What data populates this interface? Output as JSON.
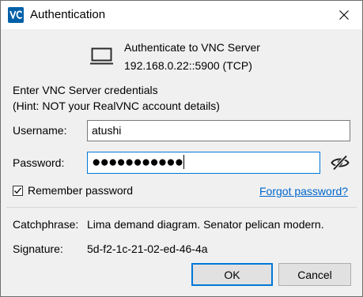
{
  "window": {
    "title": "Authentication",
    "app_icon": "vnc-viewer-icon"
  },
  "server": {
    "title": "Authenticate to VNC Server",
    "address": "192.168.0.22::5900 (TCP)"
  },
  "credentials": {
    "prompt_line1": "Enter VNC Server credentials",
    "prompt_line2": "(Hint: NOT your RealVNC account details)",
    "username_label": "Username:",
    "username_value": "atushi",
    "password_label": "Password:",
    "password_value": "●●●●●●●●●●●",
    "remember_label": "Remember password",
    "remember_checked": true,
    "forgot_link": "Forgot password?"
  },
  "identity": {
    "catchphrase_label": "Catchphrase:",
    "catchphrase_value": "Lima demand diagram. Senator pelican modern.",
    "signature_label": "Signature:",
    "signature_value": "5d-f2-1c-21-02-ed-46-4a"
  },
  "buttons": {
    "ok": "OK",
    "cancel": "Cancel"
  },
  "colors": {
    "accent": "#0078d7",
    "link": "#0066cc",
    "app_icon_bg": "#0060a8"
  }
}
